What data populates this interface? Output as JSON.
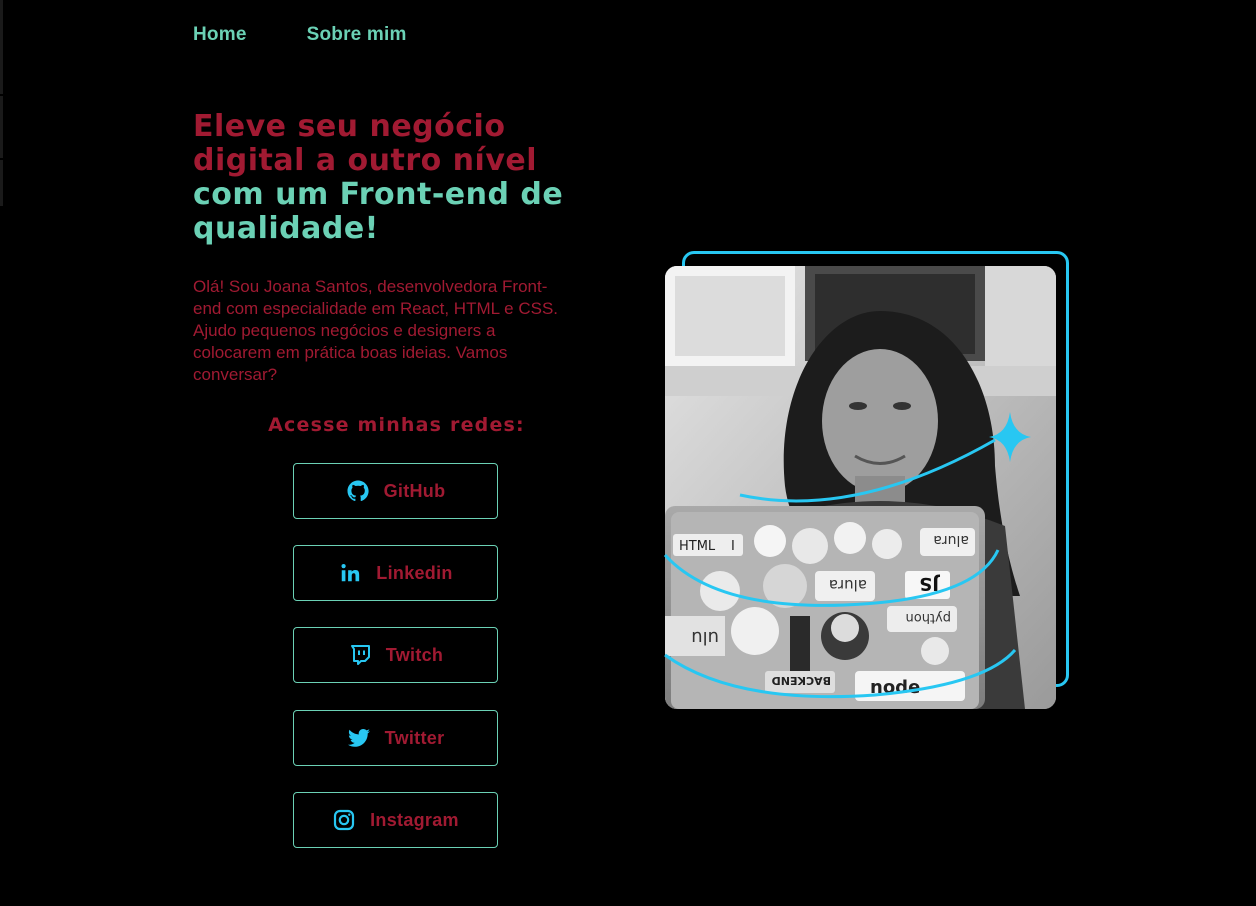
{
  "nav": {
    "home": "Home",
    "about": "Sobre mim"
  },
  "hero": {
    "headline_red": "Eleve seu negócio digital a outro nível",
    "headline_green": "com um Front-end de qualidade!",
    "intro": "Olá! Sou Joana Santos, desenvolvedora Front-end com especialidade em React, HTML e CSS. Ajudo pequenos negócios e designers a colocarem em prática boas ideias. Vamos conversar?"
  },
  "networks": {
    "title": "Acesse minhas redes:",
    "items": [
      {
        "label": "GitHub",
        "icon": "github-icon"
      },
      {
        "label": "Linkedin",
        "icon": "linkedin-icon"
      },
      {
        "label": "Twitch",
        "icon": "twitch-icon"
      },
      {
        "label": "Twitter",
        "icon": "twitter-icon"
      },
      {
        "label": "Instagram",
        "icon": "instagram-icon"
      }
    ]
  },
  "colors": {
    "background": "#000000",
    "accent_red": "#A11A32",
    "accent_green": "#6BD1B5",
    "accent_blue": "#28C7F2"
  },
  "photo": {
    "laptop_sticker_texts": [
      "HTML",
      "I",
      "alura",
      "JS",
      "alura",
      "python",
      "ulu",
      "BACKEND",
      "node"
    ]
  }
}
